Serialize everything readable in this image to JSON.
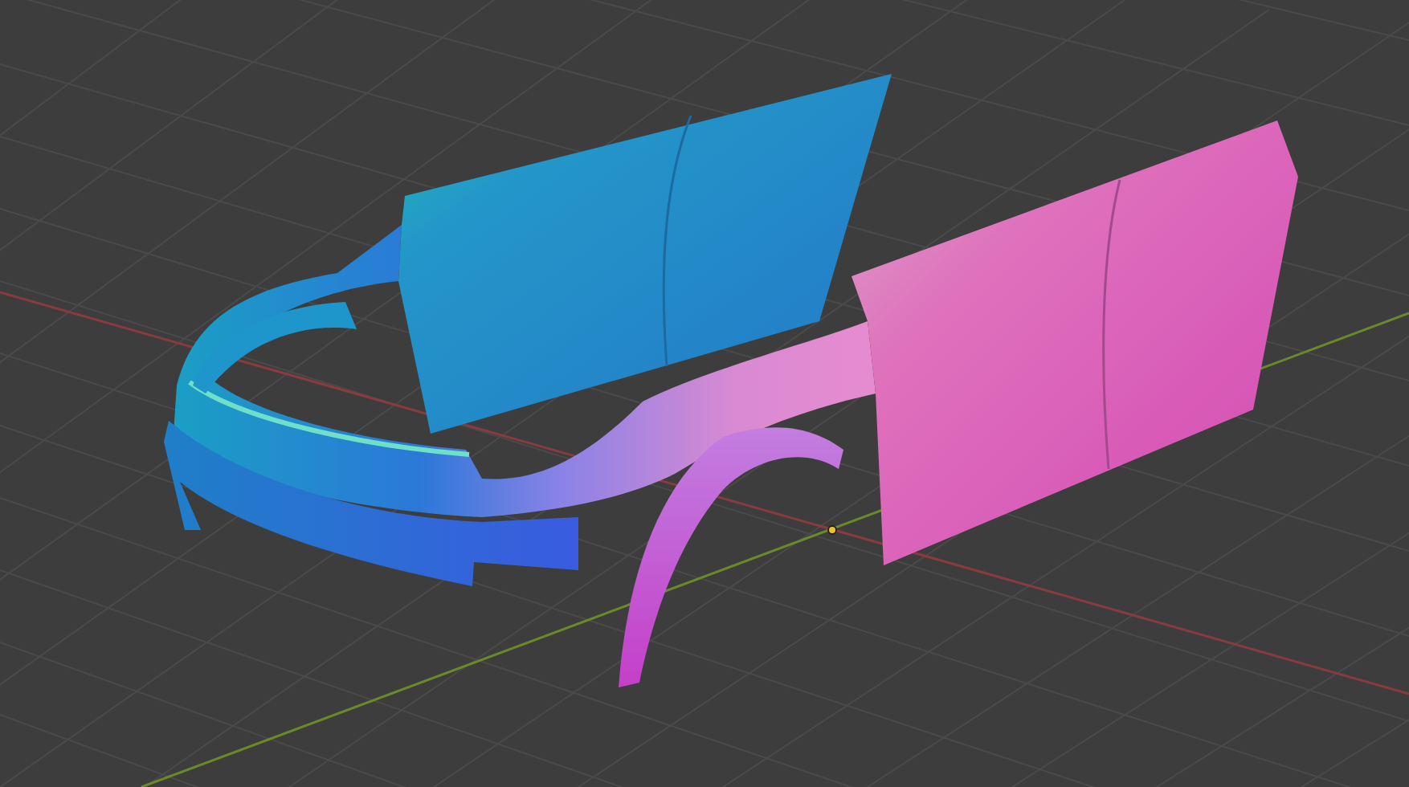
{
  "viewport": {
    "show_grid": true,
    "show_axes": true,
    "show_origin": true
  }
}
